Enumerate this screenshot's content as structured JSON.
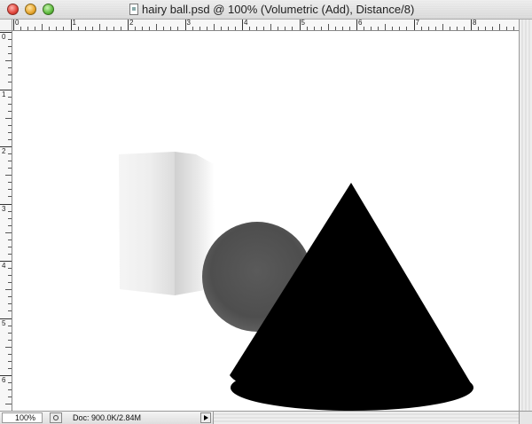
{
  "window": {
    "title": "hairy ball.psd @ 100% (Volumetric (Add), Distance/8)"
  },
  "rulers": {
    "horizontal_labels": [
      "0",
      "1",
      "2",
      "3",
      "4",
      "5",
      "6",
      "7",
      "8"
    ],
    "vertical_labels": [
      "0",
      "1",
      "2",
      "3",
      "4",
      "5",
      "6"
    ]
  },
  "status": {
    "zoom": "100%",
    "doc_info": "Doc: 900.0K/2.84M"
  },
  "colors": {
    "canvas": "#ffffff",
    "cone": "#000000",
    "sphere": "#555555",
    "box": "#e6e6e6"
  }
}
